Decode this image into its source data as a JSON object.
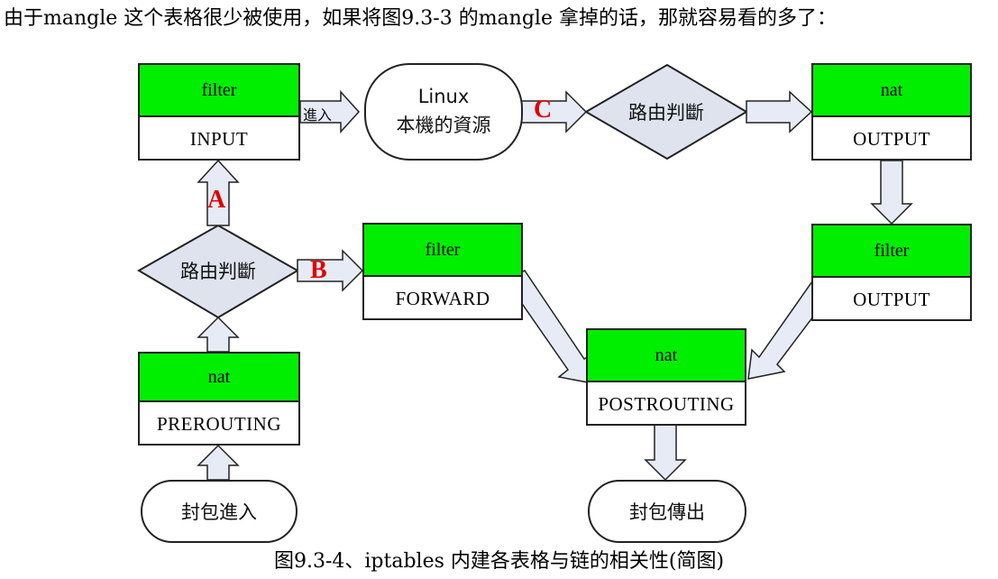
{
  "intro_text": "由于mangle 这个表格很少被使用，如果将图9.3-3 的mangle 拿掉的话，那就容易看的多了：",
  "caption": "图9.3-4、iptables 内建各表格与链的相关性(简图)",
  "nodes": {
    "input": {
      "table": "filter",
      "chain": "INPUT"
    },
    "linux_local": {
      "line1": "Linux",
      "line2": "本機的資源"
    },
    "route_top": {
      "label": "路由判斷"
    },
    "output_nat": {
      "table": "nat",
      "chain": "OUTPUT"
    },
    "route_left": {
      "label": "路由判斷"
    },
    "forward": {
      "table": "filter",
      "chain": "FORWARD"
    },
    "output_filter": {
      "table": "filter",
      "chain": "OUTPUT"
    },
    "prerouting": {
      "table": "nat",
      "chain": "PREROUTING"
    },
    "postrouting": {
      "table": "nat",
      "chain": "POSTROUTING"
    },
    "packet_in": {
      "label": "封包進入"
    },
    "packet_out": {
      "label": "封包傳出"
    }
  },
  "edge_labels": {
    "enter": "進入",
    "a": "A",
    "b": "B",
    "c": "C"
  },
  "colors": {
    "table_header": "#00ee00",
    "arrow_fill": "#e6ebf5",
    "diamond_fill": "#dfe3ee",
    "label_red": "#e00000"
  }
}
